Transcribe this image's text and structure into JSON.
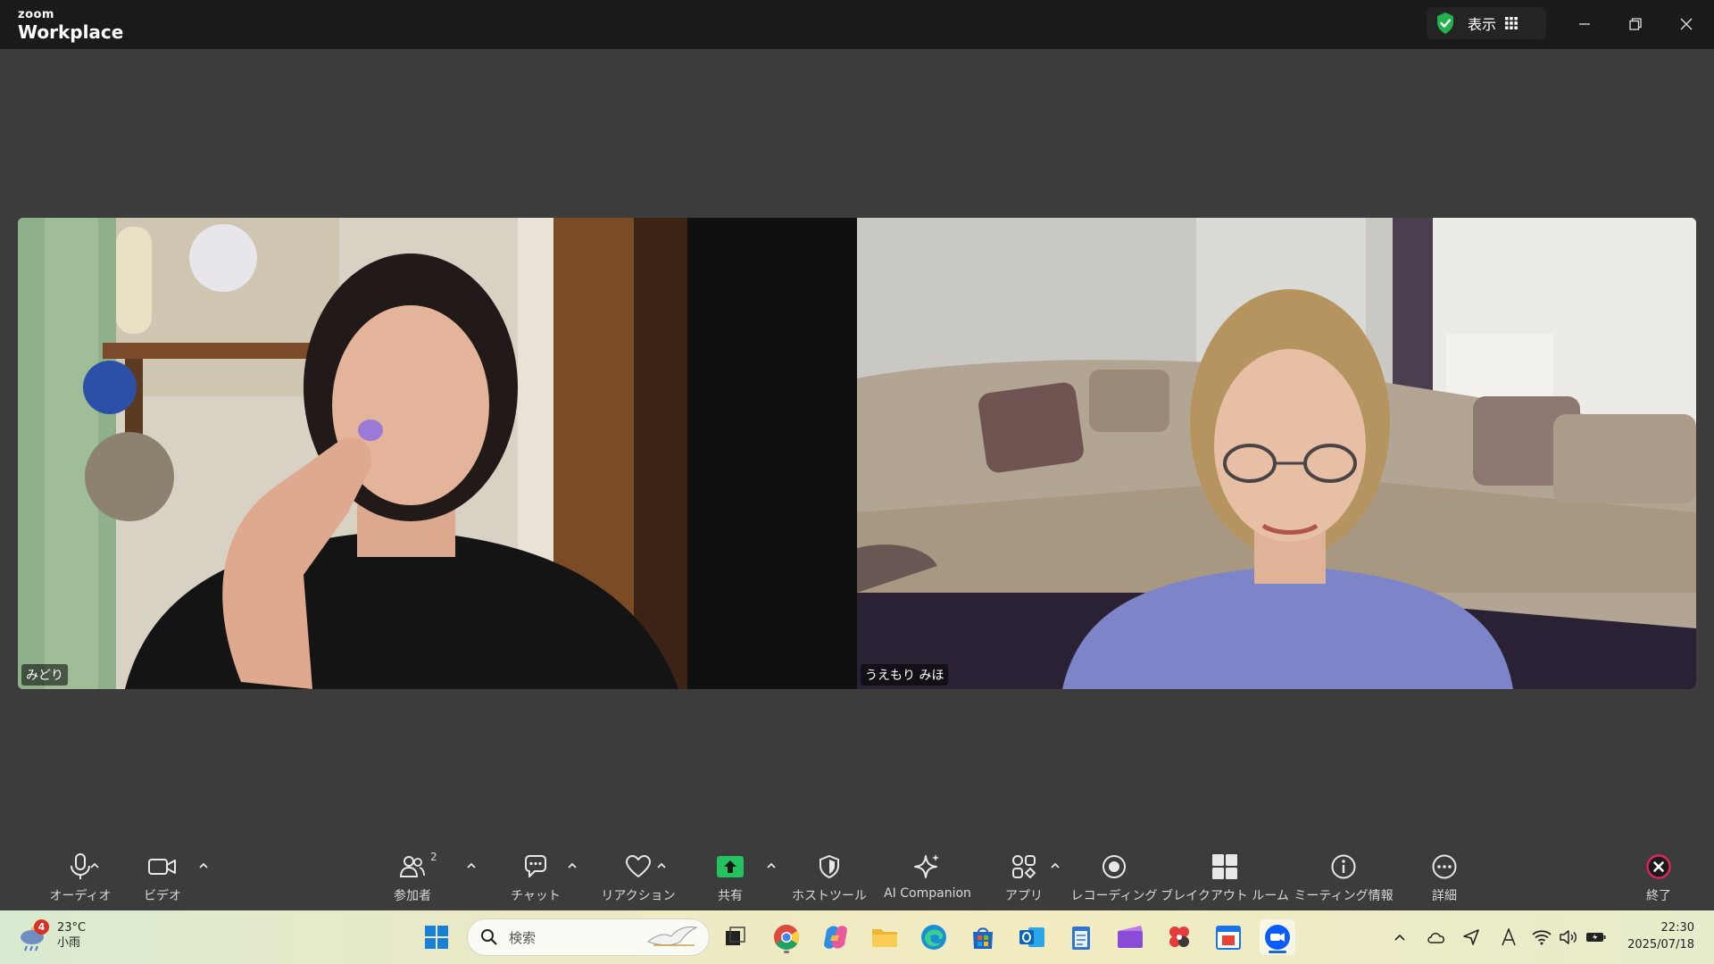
{
  "titlebar": {
    "brand_small": "zoom",
    "brand_big": "Workplace",
    "view_label": "表示"
  },
  "participants": [
    {
      "name": "みどり"
    },
    {
      "name": "うえもり みほ"
    }
  ],
  "toolbar": {
    "audio": "オーディオ",
    "video": "ビデオ",
    "participants": "参加者",
    "participants_count": "2",
    "chat": "チャット",
    "reactions": "リアクション",
    "share": "共有",
    "host_tools": "ホストツール",
    "ai_companion": "AI Companion",
    "apps": "アプリ",
    "recording": "レコーディング",
    "breakout": "ブレイクアウト ルーム",
    "meeting_info": "ミーティング情報",
    "more": "詳細",
    "end": "終了"
  },
  "taskbar": {
    "weather_temp": "23°C",
    "weather_desc": "小雨",
    "weather_alerts": "4",
    "search_placeholder": "検索",
    "time": "22:30",
    "date": "2025/07/18"
  },
  "colors": {
    "titlebar_bg": "#1a1a1a",
    "meeting_bg": "#3c3c3c",
    "share_green": "#22c45e",
    "end_red": "#e0245e",
    "shield_green": "#22b14c"
  }
}
